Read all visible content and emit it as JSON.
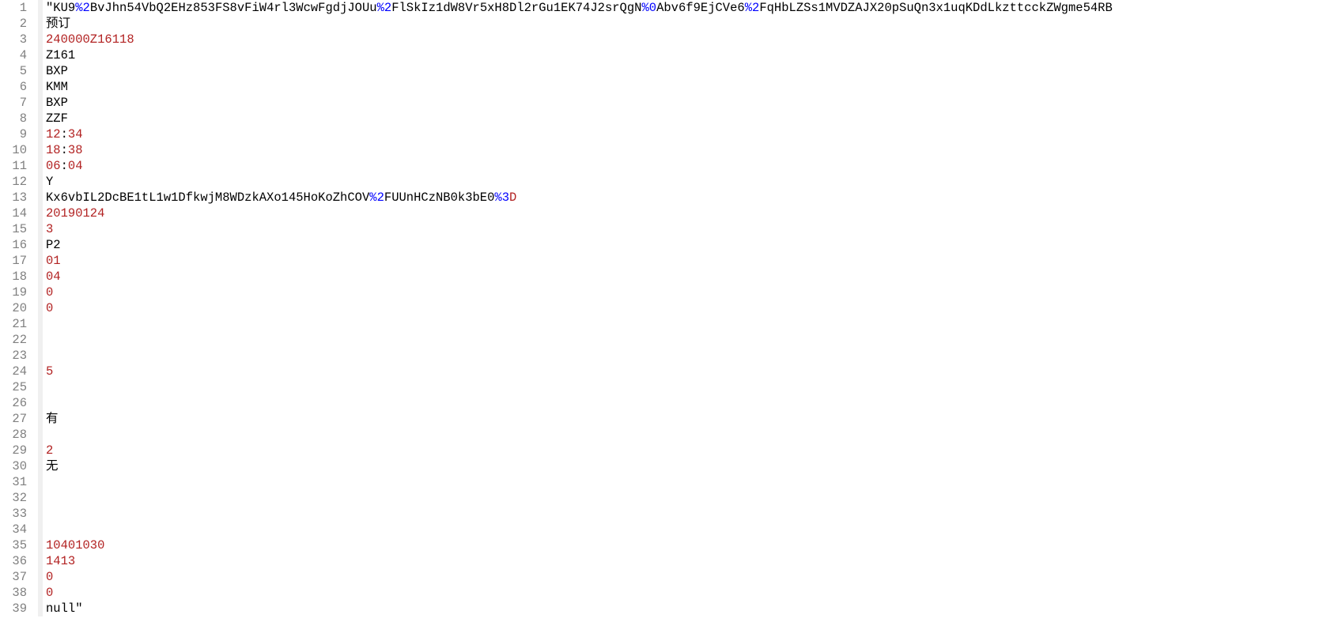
{
  "lines": [
    {
      "num": 1,
      "tokens": [
        {
          "cls": "tok-black",
          "text": "\"KU9"
        },
        {
          "cls": "tok-blue",
          "text": "%2"
        },
        {
          "cls": "tok-black",
          "text": "BvJhn54VbQ2EHz853FS8vFiW4rl3WcwFgdjJOUu"
        },
        {
          "cls": "tok-blue",
          "text": "%2"
        },
        {
          "cls": "tok-black",
          "text": "FlSkIz1dW8Vr5xH8Dl2rGu1EK74J2srQgN"
        },
        {
          "cls": "tok-blue",
          "text": "%0"
        },
        {
          "cls": "tok-black",
          "text": "Abv6f9EjCVe6"
        },
        {
          "cls": "tok-blue",
          "text": "%2"
        },
        {
          "cls": "tok-black",
          "text": "FqHbLZSs1MVDZAJX20pSuQn3x1uqKDdLkzttcckZWgme54RB"
        }
      ]
    },
    {
      "num": 2,
      "tokens": [
        {
          "cls": "tok-black",
          "text": "预订"
        }
      ]
    },
    {
      "num": 3,
      "tokens": [
        {
          "cls": "tok-red",
          "text": "240000Z16118"
        }
      ]
    },
    {
      "num": 4,
      "tokens": [
        {
          "cls": "tok-black",
          "text": "Z161"
        }
      ]
    },
    {
      "num": 5,
      "tokens": [
        {
          "cls": "tok-black",
          "text": "BXP"
        }
      ]
    },
    {
      "num": 6,
      "tokens": [
        {
          "cls": "tok-black",
          "text": "KMM"
        }
      ]
    },
    {
      "num": 7,
      "tokens": [
        {
          "cls": "tok-black",
          "text": "BXP"
        }
      ]
    },
    {
      "num": 8,
      "tokens": [
        {
          "cls": "tok-black",
          "text": "ZZF"
        }
      ]
    },
    {
      "num": 9,
      "tokens": [
        {
          "cls": "tok-red",
          "text": "12"
        },
        {
          "cls": "tok-black",
          "text": ":"
        },
        {
          "cls": "tok-red",
          "text": "34"
        }
      ]
    },
    {
      "num": 10,
      "tokens": [
        {
          "cls": "tok-red",
          "text": "18"
        },
        {
          "cls": "tok-black",
          "text": ":"
        },
        {
          "cls": "tok-red",
          "text": "38"
        }
      ]
    },
    {
      "num": 11,
      "tokens": [
        {
          "cls": "tok-red",
          "text": "06"
        },
        {
          "cls": "tok-black",
          "text": ":"
        },
        {
          "cls": "tok-red",
          "text": "04"
        }
      ]
    },
    {
      "num": 12,
      "tokens": [
        {
          "cls": "tok-black",
          "text": "Y"
        }
      ]
    },
    {
      "num": 13,
      "tokens": [
        {
          "cls": "tok-black",
          "text": "Kx6vbIL2DcBE1tL1w1DfkwjM8WDzkAXo145HoKoZhCOV"
        },
        {
          "cls": "tok-blue",
          "text": "%2"
        },
        {
          "cls": "tok-black",
          "text": "FUUnHCzNB0k3bE0"
        },
        {
          "cls": "tok-blue",
          "text": "%3"
        },
        {
          "cls": "tok-red",
          "text": "D"
        }
      ]
    },
    {
      "num": 14,
      "tokens": [
        {
          "cls": "tok-red",
          "text": "20190124"
        }
      ]
    },
    {
      "num": 15,
      "tokens": [
        {
          "cls": "tok-red",
          "text": "3"
        }
      ]
    },
    {
      "num": 16,
      "tokens": [
        {
          "cls": "tok-black",
          "text": "P2"
        }
      ]
    },
    {
      "num": 17,
      "tokens": [
        {
          "cls": "tok-red",
          "text": "01"
        }
      ]
    },
    {
      "num": 18,
      "tokens": [
        {
          "cls": "tok-red",
          "text": "04"
        }
      ]
    },
    {
      "num": 19,
      "tokens": [
        {
          "cls": "tok-red",
          "text": "0"
        }
      ]
    },
    {
      "num": 20,
      "tokens": [
        {
          "cls": "tok-red",
          "text": "0"
        }
      ]
    },
    {
      "num": 21,
      "tokens": []
    },
    {
      "num": 22,
      "tokens": []
    },
    {
      "num": 23,
      "tokens": []
    },
    {
      "num": 24,
      "tokens": [
        {
          "cls": "tok-red",
          "text": "5"
        }
      ]
    },
    {
      "num": 25,
      "tokens": []
    },
    {
      "num": 26,
      "tokens": []
    },
    {
      "num": 27,
      "tokens": [
        {
          "cls": "tok-black",
          "text": "有"
        }
      ]
    },
    {
      "num": 28,
      "tokens": []
    },
    {
      "num": 29,
      "tokens": [
        {
          "cls": "tok-red",
          "text": "2"
        }
      ]
    },
    {
      "num": 30,
      "tokens": [
        {
          "cls": "tok-black",
          "text": "无"
        }
      ]
    },
    {
      "num": 31,
      "tokens": []
    },
    {
      "num": 32,
      "tokens": []
    },
    {
      "num": 33,
      "tokens": []
    },
    {
      "num": 34,
      "tokens": []
    },
    {
      "num": 35,
      "tokens": [
        {
          "cls": "tok-red",
          "text": "10401030"
        }
      ]
    },
    {
      "num": 36,
      "tokens": [
        {
          "cls": "tok-red",
          "text": "1413"
        }
      ]
    },
    {
      "num": 37,
      "tokens": [
        {
          "cls": "tok-red",
          "text": "0"
        }
      ]
    },
    {
      "num": 38,
      "tokens": [
        {
          "cls": "tok-red",
          "text": "0"
        }
      ]
    },
    {
      "num": 39,
      "tokens": [
        {
          "cls": "tok-black",
          "text": "null\""
        }
      ]
    }
  ]
}
